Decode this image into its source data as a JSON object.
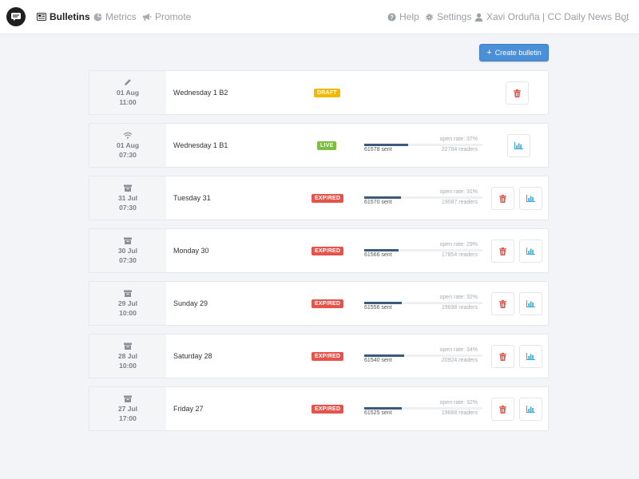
{
  "nav": {
    "tabs": [
      {
        "label": "Bulletins",
        "icon": "newspaper-icon",
        "active": true
      },
      {
        "label": "Metrics",
        "icon": "pie-chart-icon",
        "active": false
      },
      {
        "label": "Promote",
        "icon": "megaphone-icon",
        "active": false
      }
    ],
    "help": "Help",
    "settings": "Settings",
    "user": "Xavi Orduña | CC Daily News Bot"
  },
  "create_button": "Create bulletin",
  "colors": {
    "accent": "#4a90d9",
    "draft": "#f5b800",
    "live": "#7bbf3d",
    "expired": "#e5534b",
    "delete": "#e5534b",
    "stats": "#35a7e0",
    "progress": "#3c5a7a"
  },
  "bulletins": [
    {
      "status_icon": "pencil-icon",
      "date": "01 Aug",
      "time": "11:00",
      "title": "Wednesday 1 B2",
      "badge": "DRAFT",
      "badge_type": "draft"
    },
    {
      "status_icon": "wifi-icon",
      "date": "01 Aug",
      "time": "07:30",
      "title": "Wednesday 1 B1",
      "badge": "LIVE",
      "badge_type": "live",
      "sent": "61578 sent",
      "open_rate": "open rate: 37%",
      "readers": "22784 readers",
      "progress": 0.37
    },
    {
      "status_icon": "archive-icon",
      "date": "31 Jul",
      "time": "07:30",
      "title": "Tuesday 31",
      "badge": "EXPIRED",
      "badge_type": "expired",
      "sent": "61570 sent",
      "open_rate": "open rate: 31%",
      "readers": "19087 readers",
      "progress": 0.31
    },
    {
      "status_icon": "archive-icon",
      "date": "30 Jul",
      "time": "07:30",
      "title": "Monday 30",
      "badge": "EXPIRED",
      "badge_type": "expired",
      "sent": "61566 sent",
      "open_rate": "open rate: 29%",
      "readers": "17854 readers",
      "progress": 0.29
    },
    {
      "status_icon": "archive-icon",
      "date": "29 Jul",
      "time": "10:00",
      "title": "Sunday 29",
      "badge": "EXPIRED",
      "badge_type": "expired",
      "sent": "61556 sent",
      "open_rate": "open rate: 32%",
      "readers": "19698 readers",
      "progress": 0.32
    },
    {
      "status_icon": "archive-icon",
      "date": "28 Jul",
      "time": "10:00",
      "title": "Saturday 28",
      "badge": "EXPIRED",
      "badge_type": "expired",
      "sent": "61540 sent",
      "open_rate": "open rate: 34%",
      "readers": "20924 readers",
      "progress": 0.34
    },
    {
      "status_icon": "archive-icon",
      "date": "27 Jul",
      "time": "17:00",
      "title": "Friday 27",
      "badge": "EXPIRED",
      "badge_type": "expired",
      "sent": "61525 sent",
      "open_rate": "open rate: 32%",
      "readers": "19688 readers",
      "progress": 0.32
    }
  ]
}
